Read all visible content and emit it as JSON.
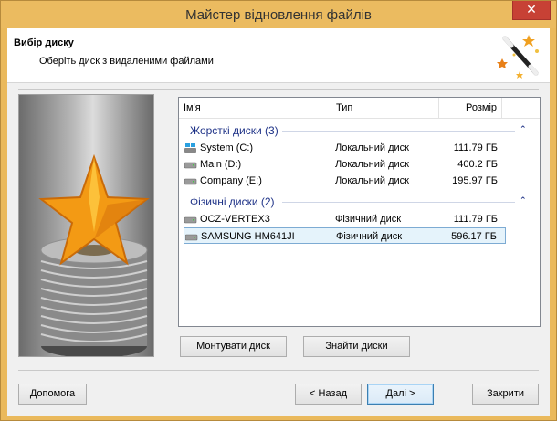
{
  "window": {
    "title": "Майстер відновлення файлів",
    "close_glyph": "✕"
  },
  "header": {
    "title": "Вибір диску",
    "subtitle": "Оберіть диск з видаленими файлами",
    "icon": "magic-wand-icon"
  },
  "list": {
    "columns": [
      "Ім'я",
      "Тип",
      "Розмір"
    ],
    "groups": [
      {
        "label": "Жорсткі диски (3)",
        "items": [
          {
            "name": "System (C:)",
            "type": "Локальний диск",
            "size": "111.79 ГБ",
            "icon": "windows-drive-icon"
          },
          {
            "name": "Main (D:)",
            "type": "Локальний диск",
            "size": "400.2 ГБ",
            "icon": "hard-drive-icon"
          },
          {
            "name": "Company (E:)",
            "type": "Локальний диск",
            "size": "195.97 ГБ",
            "icon": "hard-drive-icon"
          }
        ]
      },
      {
        "label": "Фізичні диски (2)",
        "items": [
          {
            "name": "OCZ-VERTEX3",
            "type": "Фізичний диск",
            "size": "111.79 ГБ",
            "icon": "hard-drive-icon"
          },
          {
            "name": "SAMSUNG HM641JI",
            "type": "Фізичний диск",
            "size": "596.17 ГБ",
            "icon": "hard-drive-icon",
            "selected": true
          }
        ]
      }
    ]
  },
  "buttons": {
    "mount": "Монтувати диск",
    "find": "Знайти диски",
    "help": "Допомога",
    "back": "< Назад",
    "next": "Далі >",
    "close": "Закрити"
  },
  "colors": {
    "group_text": "#1e3287",
    "selection_bg": "#e5f3fb",
    "selection_border": "#7dabd3",
    "frame": "#eab95c",
    "close_button": "#c74135"
  }
}
